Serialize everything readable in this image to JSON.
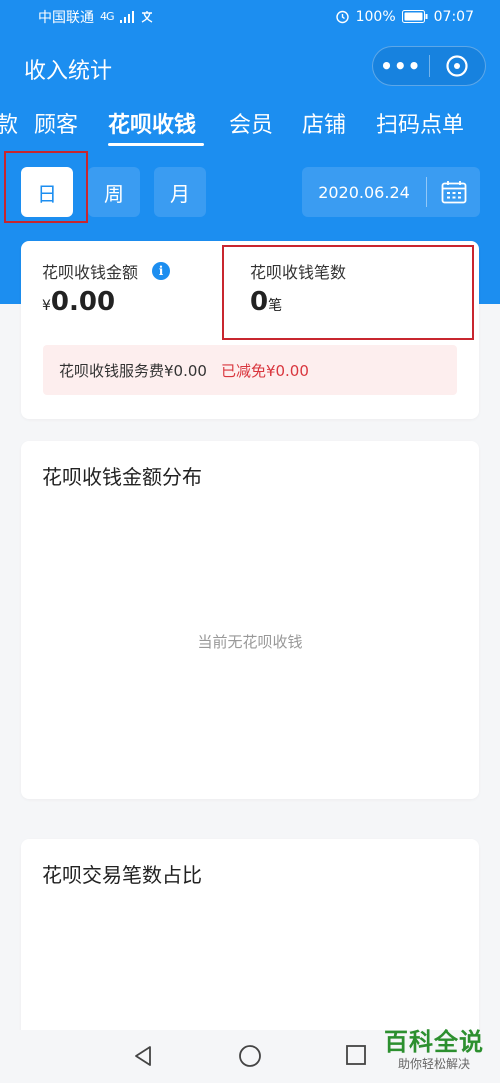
{
  "status_bar": {
    "carrier": "中国联通",
    "network": "4G",
    "battery": "100%",
    "time": "07:07"
  },
  "header": {
    "title": "收入统计",
    "more_label": "•••"
  },
  "tabs": [
    {
      "label": "款",
      "active": false
    },
    {
      "label": "顾客",
      "active": false
    },
    {
      "label": "花呗收钱",
      "active": true
    },
    {
      "label": "会员",
      "active": false
    },
    {
      "label": "店铺",
      "active": false
    },
    {
      "label": "扫码点单",
      "active": false
    }
  ],
  "period": {
    "day": "日",
    "week": "周",
    "month": "月",
    "selected": "day",
    "date": "2020.06.24"
  },
  "summary": {
    "amount_label": "花呗收钱金额",
    "currency_symbol": "¥",
    "amount_value": "0.00",
    "count_label": "花呗收钱笔数",
    "count_value": "0",
    "count_unit": "笔",
    "fee_label": "花呗收钱服务费¥0.00",
    "fee_discount": "已减免¥0.00"
  },
  "distribution": {
    "title": "花呗收钱金额分布",
    "empty_text": "当前无花呗收钱"
  },
  "transactions": {
    "title": "花呗交易笔数占比"
  },
  "watermark": {
    "main": "百科全说",
    "sub": "助你轻松解决"
  },
  "colors": {
    "brand_blue": "#1c8ef0",
    "highlight_red": "#c8262f",
    "discount_red": "#d9363e",
    "watermark_green": "#2c8f2f"
  }
}
